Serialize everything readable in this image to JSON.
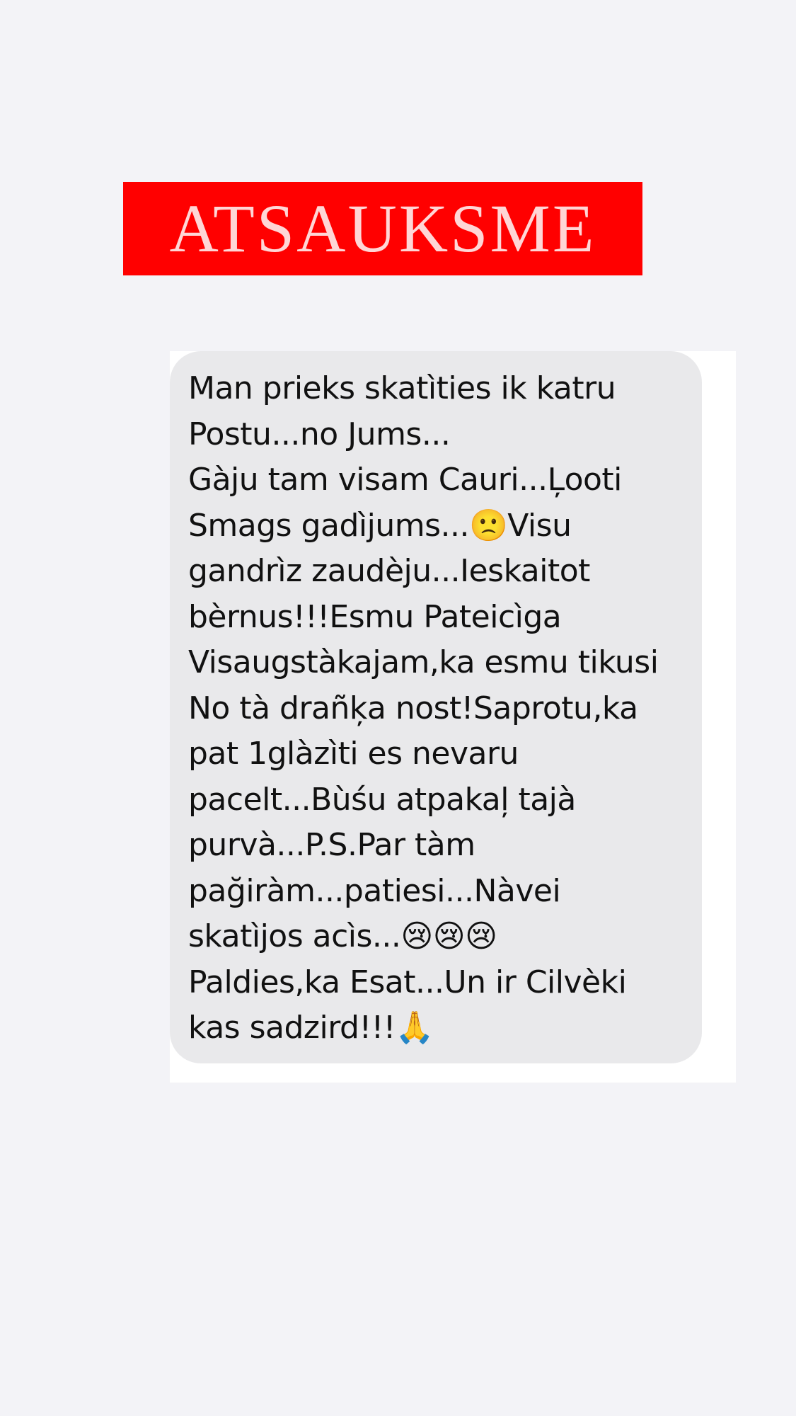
{
  "banner": {
    "title": "ATSAUKSME"
  },
  "message": {
    "lines": [
      "Man prieks skatìties ik katru",
      "Postu...no Jums...",
      "Gàju tam visam Cauri...Ļooti",
      "Smags gadìjums...🙁Visu",
      "gandrìz zaudèju...Ieskaitot",
      "bèrnus!!!Esmu Pateicìga",
      "Visaugstàkajam,ka esmu tikusi",
      "No tà drañķa nost!Saprotu,ka",
      "pat 1glàzìti es nevaru",
      "pacelt...Bùśu atpakaļ tajà",
      "purvà...P.S.Par tàm",
      "pağiràm...patiesi...Nàvei",
      "skatìjos acìs...😢😢😢",
      "Paldies,ka Esat...Un ir Cilvèki",
      "kas sadzird!!!🙏"
    ]
  },
  "colors": {
    "page_background": "#f3f3f7",
    "banner_background": "#ff0000",
    "banner_text": "#ffd6d6",
    "card_background": "#ffffff",
    "bubble_background": "#e9e9eb",
    "message_text": "#111111"
  }
}
